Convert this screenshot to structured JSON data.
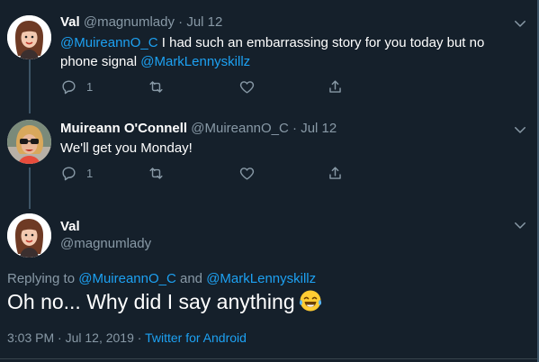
{
  "colors": {
    "background": "#15202b",
    "text": "#ffffff",
    "muted": "#8899a6",
    "link": "#1da1f2",
    "divider": "#38444d"
  },
  "tweets": [
    {
      "name": "Val",
      "handle": "@magnumlady",
      "separator": "·",
      "date": "Jul 12",
      "mention1": "@MuireannO_C",
      "text": " I had such an embarrassing story for you today but no phone signal ",
      "mention2": "@MarkLennyskillz",
      "reply_count": "1",
      "icons": [
        "reply-icon",
        "retweet-icon",
        "like-icon",
        "share-icon",
        "chevron-down-icon"
      ]
    },
    {
      "name": "Muireann O'Connell",
      "handle": "@MuireannO_C",
      "separator": "·",
      "date": "Jul 12",
      "text": "We'll get you Monday!",
      "reply_count": "1",
      "icons": [
        "reply-icon",
        "retweet-icon",
        "like-icon",
        "share-icon",
        "chevron-down-icon"
      ]
    }
  ],
  "focus": {
    "name": "Val",
    "handle": "@magnumlady",
    "replying_prefix": "Replying to ",
    "replying_to_1": "@MuireannO_C",
    "replying_and": " and ",
    "replying_to_2": "@MarkLennyskillz",
    "text": "Oh no... Why did I say anything",
    "emoji": "face-with-tears-of-joy",
    "time": "3:03 PM",
    "separator": "·",
    "date": "Jul 12, 2019",
    "separator2": "·",
    "source": "Twitter for Android"
  }
}
